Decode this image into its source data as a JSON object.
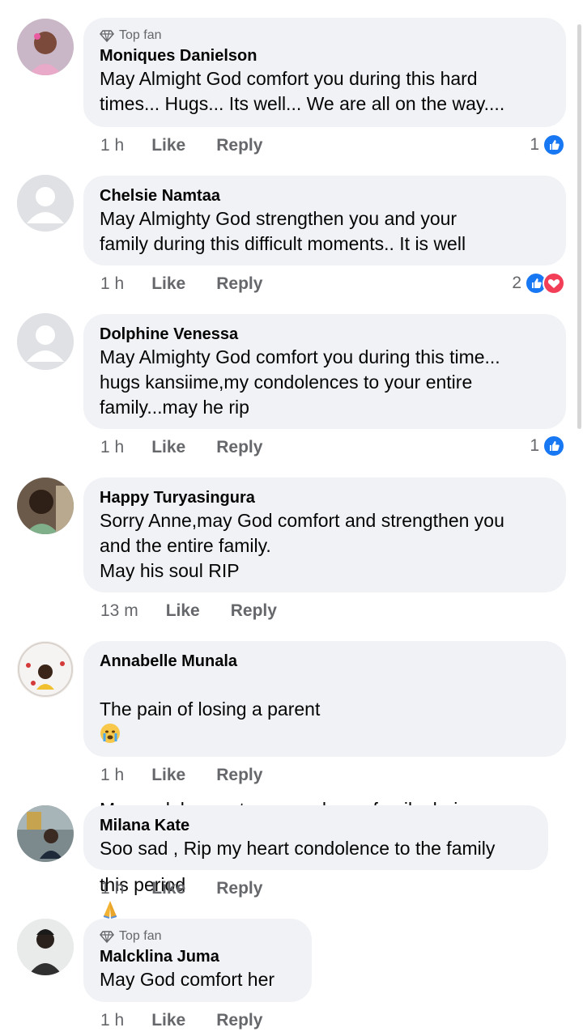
{
  "comments": [
    {
      "top_fan": "Top fan",
      "author": "Moniques Danielson",
      "text": "May Almight God comfort you during this hard\ntimes... Hugs... Its well... We are all on the way....",
      "time": "1 h",
      "like": "Like",
      "reply": "Reply",
      "reaction_count": "1"
    },
    {
      "author": "Chelsie Namtaa",
      "text": "May Almighty God strengthen you and your\nfamily during this difficult moments.. It is well",
      "time": "1 h",
      "like": "Like",
      "reply": "Reply",
      "reaction_count": "2"
    },
    {
      "author": "Dolphine Venessa",
      "text": "May Almighty God comfort you during this time...\nhugs kansiime,my condolences to your entire\nfamily...may he rip",
      "time": "1 h",
      "like": "Like",
      "reply": "Reply",
      "reaction_count": "1"
    },
    {
      "author": "Happy Turyasingura",
      "text": "Sorry Anne,may God comfort and strengthen you\nand the entire family.\nMay his soul RIP",
      "time": "13 m",
      "like": "Like",
      "reply": "Reply"
    },
    {
      "author": "Annabelle Munala",
      "text_line1": "The pain of losing a parent",
      "text_line2": "My condolences to you and your family during",
      "text_line3": "this period",
      "time": "1 h",
      "like": "Like",
      "reply": "Reply"
    },
    {
      "author": "Milana Kate",
      "text": "Soo sad , Rip my heart condolence to the family",
      "time": "1 h",
      "like": "Like",
      "reply": "Reply"
    },
    {
      "top_fan": "Top fan",
      "author": "Malcklina Juma",
      "text": "May God comfort her",
      "time": "1 h",
      "like": "Like",
      "reply": "Reply"
    }
  ],
  "colors": {
    "bubble": "#f0f2f5",
    "meta_text": "#65676b",
    "like_blue": "#1877f2",
    "love_red": "#f33e58"
  }
}
